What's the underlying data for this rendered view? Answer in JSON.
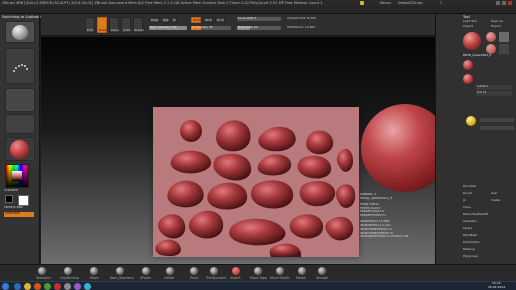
{
  "title_bar": {
    "text": "ZBrush 4R6  [QUILLS ERROR-(SCULPT) 2014-04-01]  ZBrush Document    Mem 8/2   Free Mem 2 2.0 GB  Active Mem  Scratch Disk 0 Timer 0.02 PolyCount 0.01 MP Free  Meshes Count 1"
  },
  "top_right": {
    "menus_label": "Menus",
    "script_label": "DefaultZScript",
    "help_label": "?"
  },
  "left_shelf": {
    "switching_label": "Switching to Subtool 0",
    "lightbox_label": "LightBox",
    "material_label": "Material",
    "gradient_label": "Gradient",
    "switch_color_label": "SwitchColor",
    "alternate_label": "Alternate"
  },
  "toolbar": {
    "edit": "Edit",
    "draw": "Draw",
    "move": "Move",
    "scale": "Scale",
    "rotate": "Rotate",
    "mrgb": "Mrgb",
    "rgb": "Rgb",
    "m": "M",
    "rgb_intensity_label": "Rgb Intensity 100",
    "rgb_intensity_value": 1.0,
    "zadd": "Zadd",
    "zsub": "Zsub",
    "zcut": "Zcut",
    "z_intensity_label": "Z Intensity 25",
    "z_intensity_value": 0.25,
    "focal_shift_label": "Focal Shift 0",
    "draw_size_label": "Draw Size 64",
    "draw_size_value": 0.3,
    "active_points_label": "ActivePoints: 8,205",
    "total_points_label": "TotalPoints: 13,824"
  },
  "stats_panel": {
    "lines": [
      "Subtool: 0",
      "PM3D_Sphere3D2_9",
      "",
      "Polys=9632",
      "Points=8205",
      "HiddenPolys=0",
      "HiddenPoints=0",
      "",
      "TotalPolys=13,568",
      "TotalPoints=13,341",
      "TotalHiddenPolys=0",
      "TotalHiddenPoints=0",
      "TotalAgreePolys=0.000002 Mil"
    ]
  },
  "right_tray": {
    "header": "Tool",
    "load_tool": "Load Tool",
    "save_as": "Save As",
    "import": "Import",
    "export": "Export",
    "clone": "Clone",
    "make_polymesh": "Make PolyMesh3D",
    "goz": "GoZ",
    "all": "All",
    "visible": "Visible",
    "lightbox_tools": "Lightbox > Tools",
    "current_tool": "PM3D_Sphere3D2_9",
    "subtool": "SubTool",
    "list_all": "List All",
    "del_other": "Del Other",
    "del_all": "Del All",
    "geometry": "Geometry",
    "layers": "Layers",
    "fibermesh": "FiberMesh",
    "deformation": "Deformation",
    "masking": "Masking",
    "polygroups": "Polygroups",
    "split": "Split",
    "merge": "Merge",
    "remesh": "Remesh",
    "project": "Project",
    "extract": "Extract",
    "items": [
      "Lightbox",
      "SubTool",
      "Geometry",
      "Layers",
      "FiberMesh",
      "Deformation",
      "Masking",
      "Polygroups",
      "Contact",
      "Morph Target",
      "Polypaint",
      "UV Map",
      "Texture Map",
      "Displacement Map",
      "Normal Map",
      "Vector Displacement",
      "Display Properties",
      "Unified Skin",
      "Initialize",
      "Import",
      "Export"
    ]
  },
  "right_strip": {
    "items": [
      "Bpr",
      "SPix 3",
      "Scroll",
      "Zoom",
      "Actual",
      "AAHalf",
      "Persp",
      "Floor",
      "Local",
      "LSym",
      "Xyz",
      "Frame",
      "Move",
      "Scale",
      "Rotate",
      "PolyF",
      "Transp",
      "Ghost",
      "Solo",
      "Xpose"
    ]
  },
  "bottom_shelf": {
    "brushes": [
      "Standard",
      "ClayBuildup",
      "Move",
      "Dam_Standard",
      "hPolish",
      "Inflate",
      "Pinch",
      "TrimDynamic",
      "Slash3",
      "Move Topo",
      "Move Elastic",
      "Morph",
      "Smooth"
    ]
  },
  "taskbar": {
    "time": "15:25",
    "date": "26.04.2014"
  },
  "colors": {
    "accent_orange": "#e07a1c",
    "material_red": "#b83b3b",
    "clay_red": "#a93639"
  }
}
